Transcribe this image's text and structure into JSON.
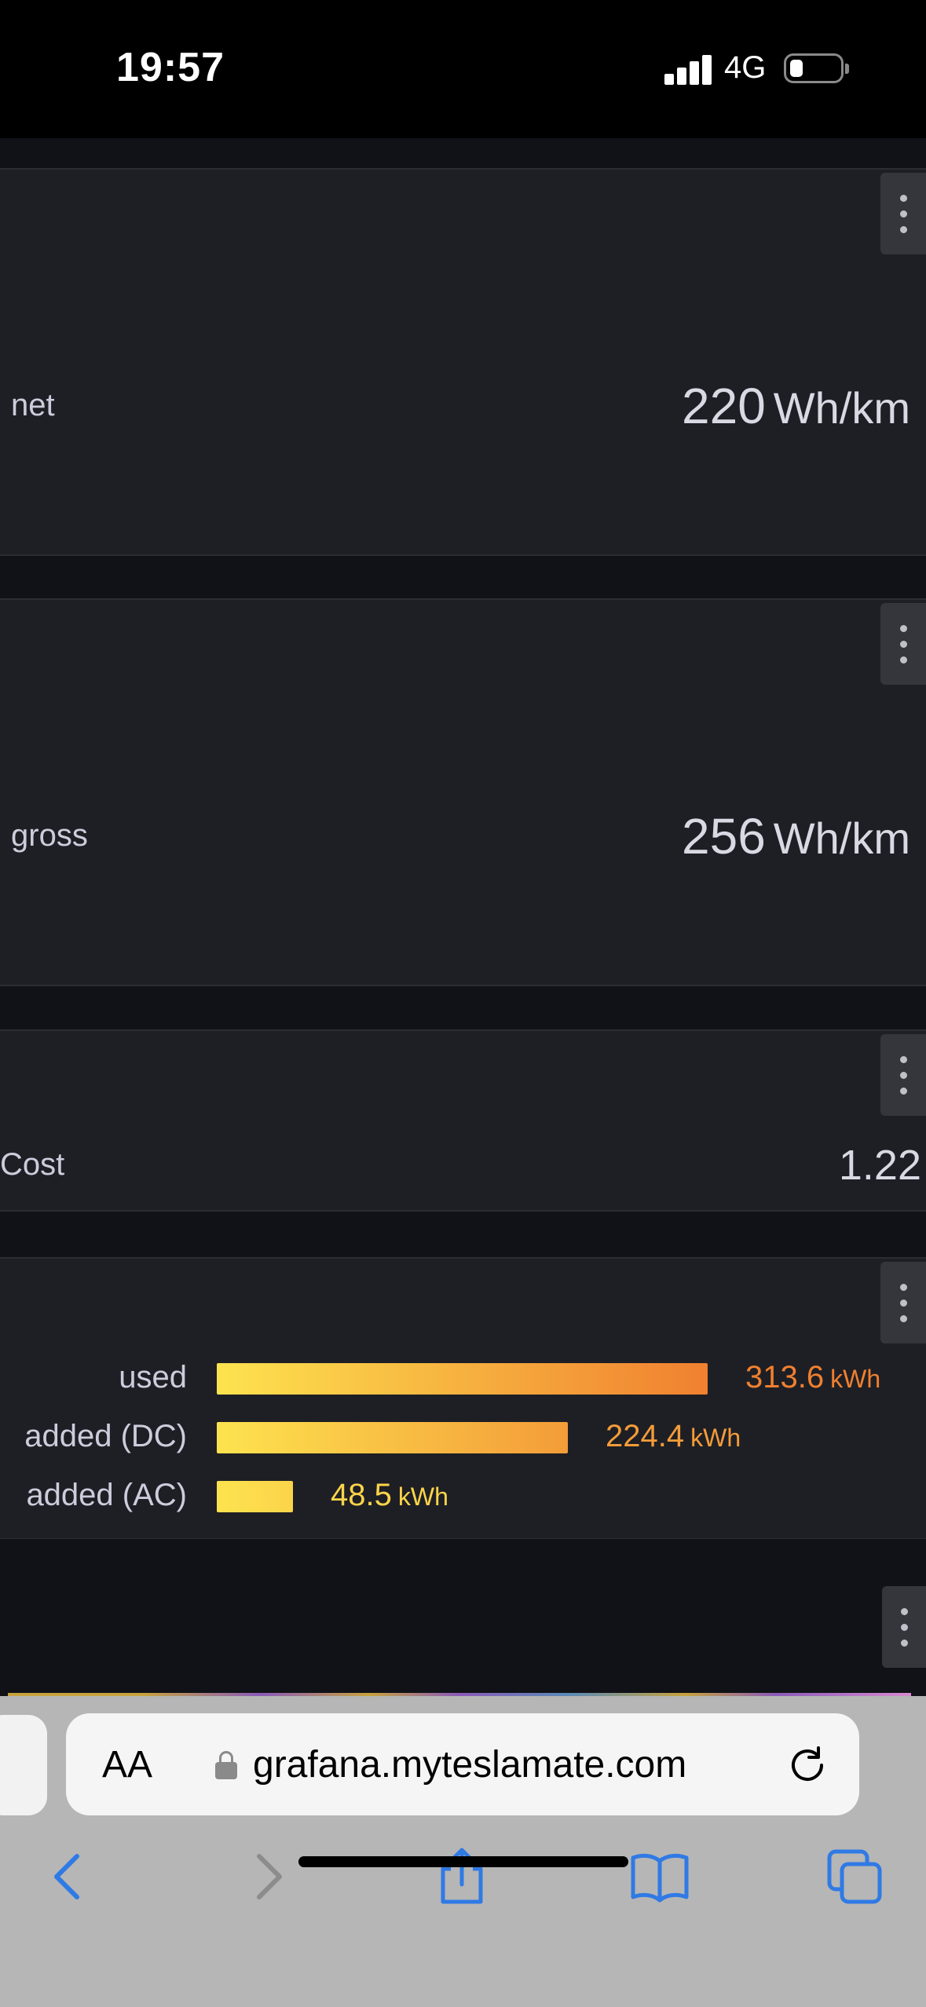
{
  "status_bar": {
    "time": "19:57",
    "network": "4G"
  },
  "panels": {
    "net": {
      "label": "net",
      "value": "220",
      "unit": "Wh/km"
    },
    "gross": {
      "label": "gross",
      "value": "256",
      "unit": "Wh/km"
    },
    "cost": {
      "label": "Cost",
      "value": "1.22"
    }
  },
  "energy_bars": [
    {
      "label": "used",
      "value": "313.6",
      "unit": "kWh",
      "amount": 313.6
    },
    {
      "label": "added (DC)",
      "value": "224.4",
      "unit": "kWh",
      "amount": 224.4
    },
    {
      "label": "added (AC)",
      "value": "48.5",
      "unit": "kWh",
      "amount": 48.5
    }
  ],
  "colors": {
    "bar_start": "#fde34f",
    "bar_end": "#f08030",
    "panel_bg": "#1e1f24"
  },
  "browser": {
    "text_size_button": "AA",
    "url": "grafana.myteslamate.com",
    "icons": [
      "back-icon",
      "forward-icon",
      "share-icon",
      "bookmarks-icon",
      "tabs-icon",
      "reload-icon",
      "lock-icon"
    ]
  }
}
